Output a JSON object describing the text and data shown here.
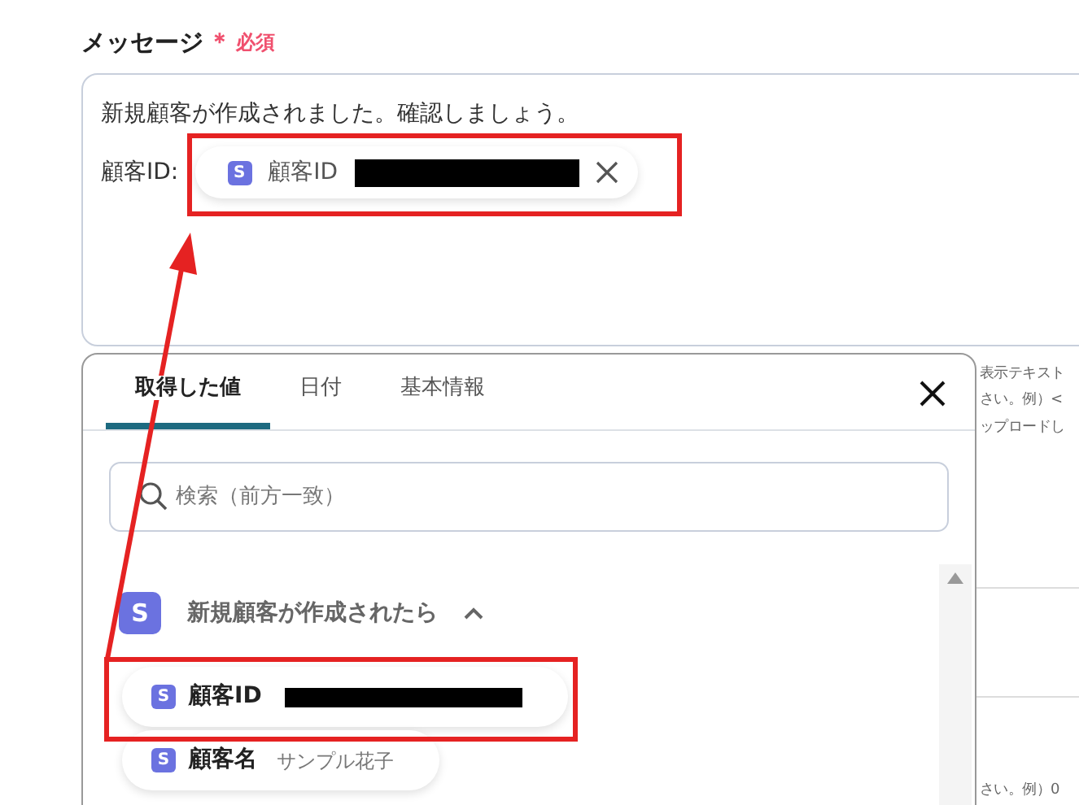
{
  "field": {
    "label": "メッセージ",
    "required_mark": "＊",
    "required_text": "必須",
    "lines": [
      "新規顧客が作成されました。確認しましょう。"
    ],
    "inline_label": "顧客ID:",
    "token": {
      "badge": "S",
      "label": "顧客ID",
      "redacted": true
    }
  },
  "background_texts": [
    {
      "text": "表示テキスト"
    },
    {
      "text": "さい。例）<"
    },
    {
      "text": "ップロードし"
    },
    {
      "text": "さい。例）0"
    }
  ],
  "popup": {
    "tabs": [
      {
        "label": "取得した値",
        "selected": true
      },
      {
        "label": "日付",
        "selected": false
      },
      {
        "label": "基本情報",
        "selected": false
      }
    ],
    "search": {
      "placeholder": "検索（前方一致）"
    },
    "group": {
      "badge": "S",
      "title": "新規顧客が作成されたら",
      "expanded": true
    },
    "items": [
      {
        "badge": "S",
        "label": "顧客ID",
        "value": "",
        "redacted": true
      },
      {
        "badge": "S",
        "label": "顧客名",
        "value": "サンプル花子",
        "redacted": false
      }
    ]
  }
}
